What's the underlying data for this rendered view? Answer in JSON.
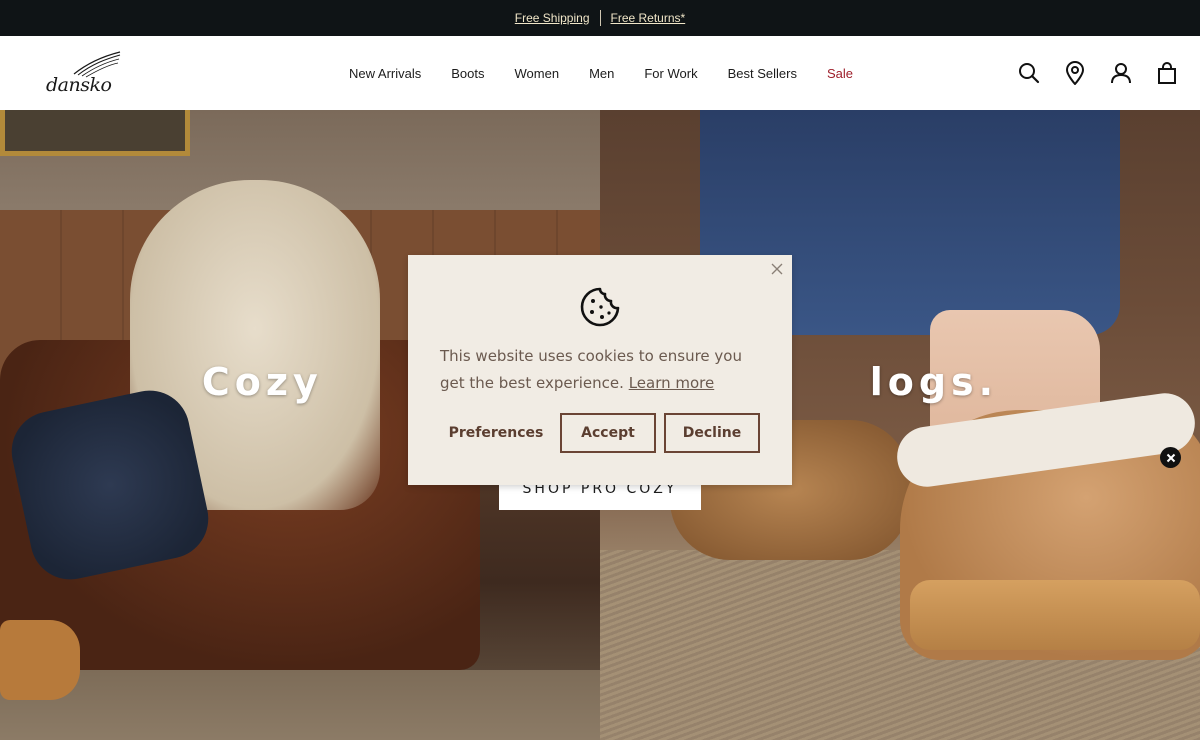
{
  "promo": {
    "shipping": "Free Shipping",
    "returns": "Free Returns*"
  },
  "header": {
    "logo_text": "dansko",
    "nav": [
      {
        "label": "New Arrivals"
      },
      {
        "label": "Boots"
      },
      {
        "label": "Women"
      },
      {
        "label": "Men"
      },
      {
        "label": "For Work"
      },
      {
        "label": "Best Sellers"
      },
      {
        "label": "Sale",
        "color": "#9e1f2b"
      }
    ],
    "icons": [
      "search-icon",
      "location-icon",
      "account-icon",
      "cart-icon"
    ]
  },
  "hero": {
    "title_visible": "Cozy                              logs.",
    "subtitle_visible": "S                                                              .",
    "cta": "SHOP PRO COZY"
  },
  "cookie": {
    "message": "This website uses cookies to ensure you get the best experience.",
    "learn_more": "Learn more",
    "preferences": "Preferences",
    "accept": "Accept",
    "decline": "Decline"
  },
  "colors": {
    "promo_bg": "#0f1416",
    "modal_bg": "#f1ece4",
    "button_text": "#5b3e30",
    "sale": "#9e1f2b"
  }
}
